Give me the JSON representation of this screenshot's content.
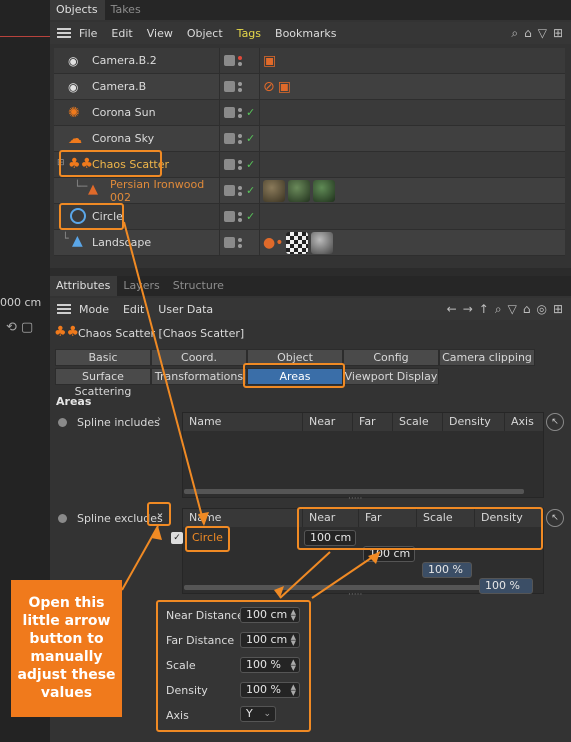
{
  "viewport": {
    "coord_label": "000 cm"
  },
  "objects_panel": {
    "tabs": [
      "Objects",
      "Takes"
    ],
    "menu": [
      "File",
      "Edit",
      "View",
      "Object",
      "Tags",
      "Bookmarks"
    ],
    "rows": [
      {
        "name": "Camera.B.2"
      },
      {
        "name": "Camera.B"
      },
      {
        "name": "Corona Sun"
      },
      {
        "name": "Corona Sky"
      },
      {
        "name": "Chaos Scatter"
      },
      {
        "name": "Persian Ironwood 002"
      },
      {
        "name": "Circle"
      },
      {
        "name": "Landscape"
      }
    ]
  },
  "attributes_panel": {
    "tabs": [
      "Attributes",
      "Layers",
      "Structure"
    ],
    "menu": [
      "Mode",
      "Edit",
      "User Data"
    ],
    "object_title": "Chaos Scatter [Chaos Scatter]",
    "buttons_row1": [
      "Basic",
      "Coord.",
      "Object",
      "Config",
      "Camera clipping"
    ],
    "buttons_row2": [
      "Surface Scattering",
      "Transformations",
      "Areas",
      "Viewport Display"
    ],
    "section": "Areas",
    "spline_includes": {
      "label": "Spline includes",
      "columns": [
        "Name",
        "Near",
        "Far",
        "Scale",
        "Density",
        "Axis"
      ]
    },
    "spline_excludes": {
      "label": "Spline excludes",
      "columns": [
        "Name",
        "Near",
        "Far",
        "Scale",
        "Density"
      ],
      "row": {
        "name": "Circle",
        "near": "100 cm",
        "far": "100 cm",
        "scale": "100 %",
        "density": "100 %"
      }
    }
  },
  "popup": {
    "near_label": "Near Distance",
    "near_value": "100 cm",
    "far_label": "Far Distance",
    "far_value": "100 cm",
    "scale_label": "Scale",
    "scale_value": "100 %",
    "density_label": "Density",
    "density_value": "100 %",
    "axis_label": "Axis",
    "axis_value": "Y"
  },
  "callout": {
    "text": "Open this little arrow button to manually adjust these values"
  },
  "colors": {
    "highlight": "#f08a24",
    "selected_tab": "#3a6ea8",
    "callout_bg": "#f07a1c"
  }
}
